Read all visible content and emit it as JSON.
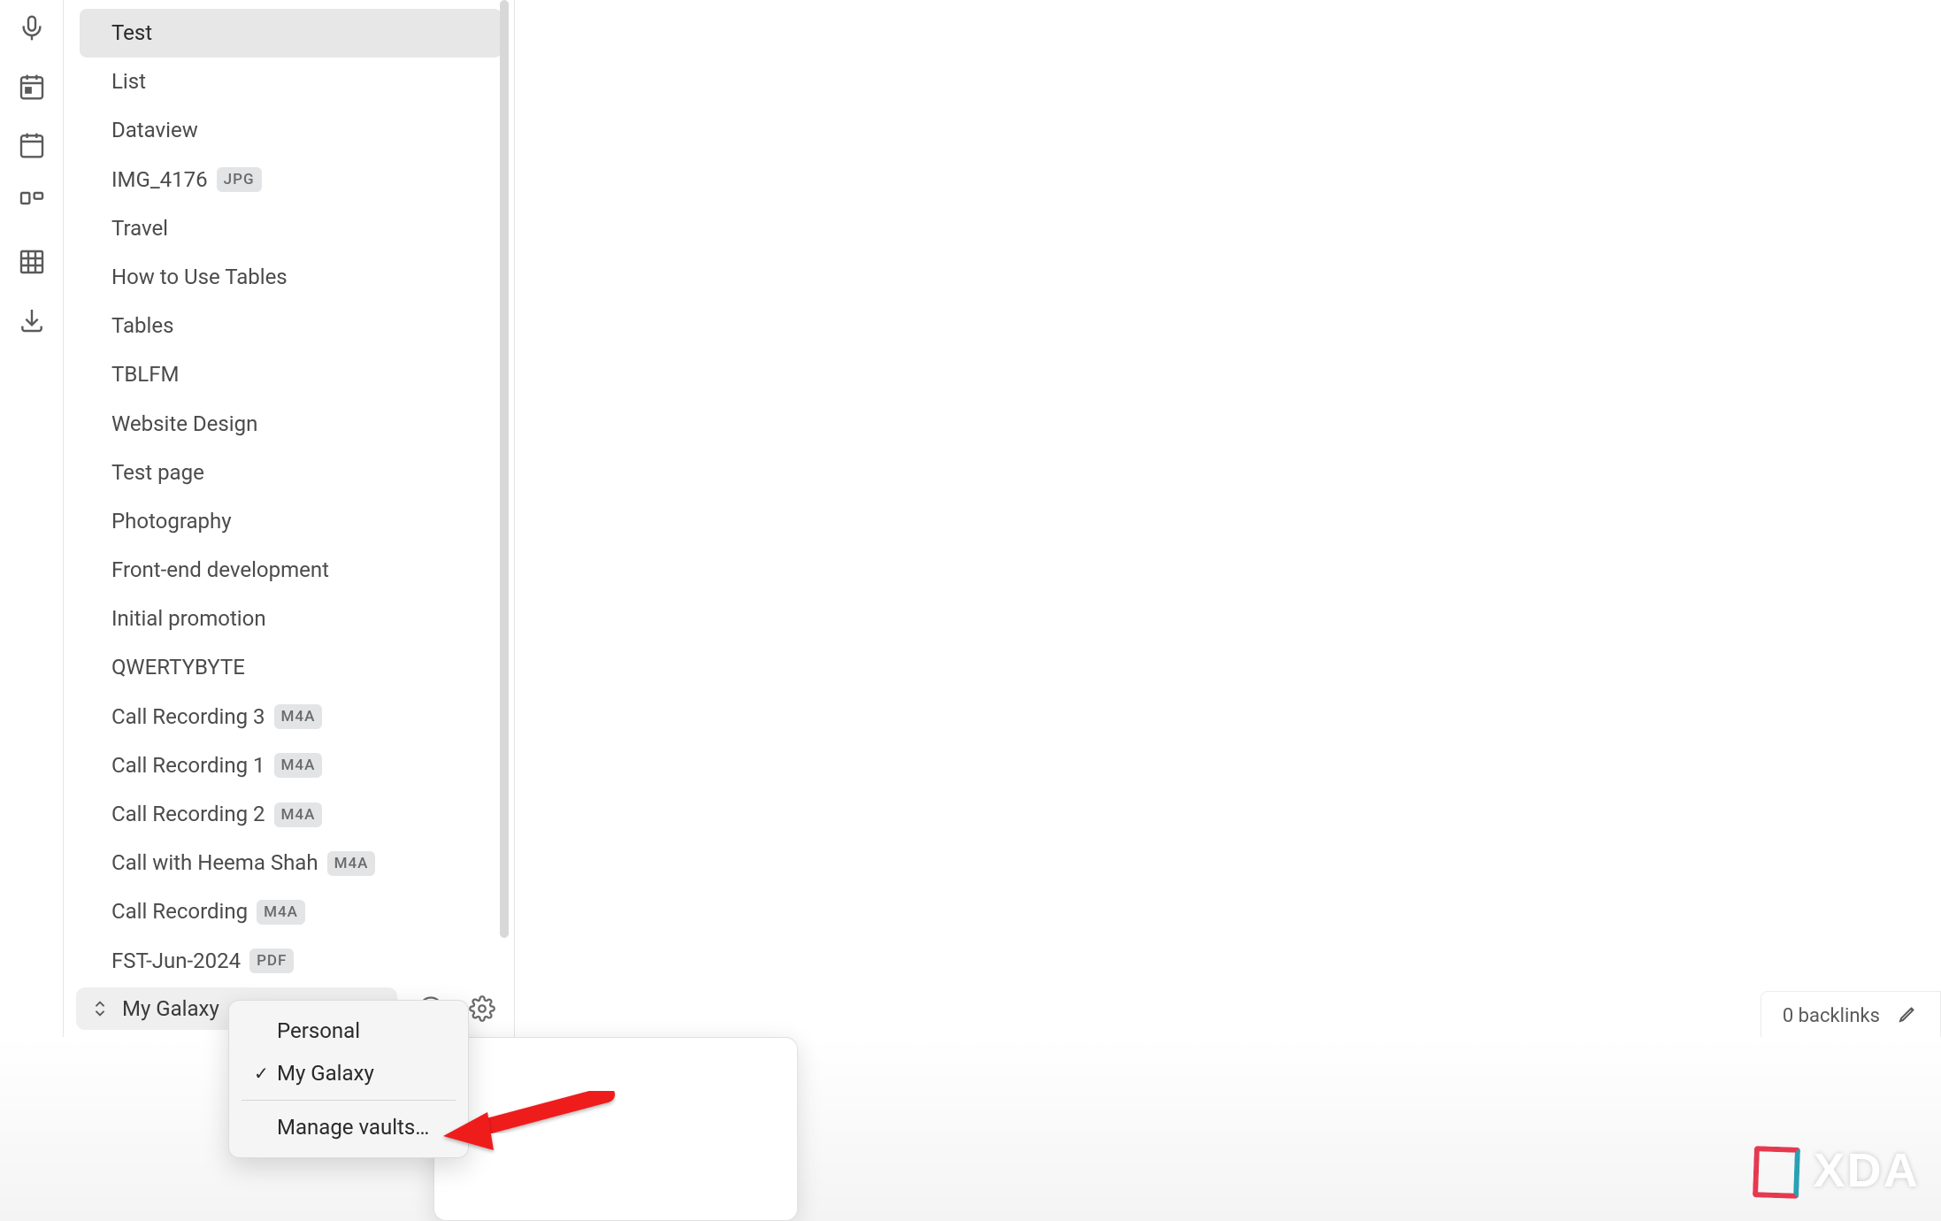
{
  "ribbon": {
    "items": [
      {
        "name": "mic",
        "icon": "mic"
      },
      {
        "name": "calendar-day",
        "icon": "calendar-day"
      },
      {
        "name": "calendar",
        "icon": "calendar"
      },
      {
        "name": "board",
        "icon": "board"
      },
      {
        "name": "table",
        "icon": "table"
      },
      {
        "name": "download",
        "icon": "download"
      }
    ]
  },
  "files": [
    {
      "label": "Test",
      "badge": null,
      "active": true
    },
    {
      "label": "List",
      "badge": null
    },
    {
      "label": "Dataview",
      "badge": null
    },
    {
      "label": "IMG_4176",
      "badge": "JPG"
    },
    {
      "label": "Travel",
      "badge": null
    },
    {
      "label": "How to Use Tables",
      "badge": null
    },
    {
      "label": "Tables",
      "badge": null
    },
    {
      "label": "TBLFM",
      "badge": null
    },
    {
      "label": "Website Design",
      "badge": null
    },
    {
      "label": "Test page",
      "badge": null
    },
    {
      "label": "Photography",
      "badge": null
    },
    {
      "label": "Front-end development",
      "badge": null
    },
    {
      "label": "Initial promotion",
      "badge": null
    },
    {
      "label": "QWERTYBYTE",
      "badge": null
    },
    {
      "label": "Call Recording 3",
      "badge": "M4A"
    },
    {
      "label": "Call Recording 1",
      "badge": "M4A"
    },
    {
      "label": "Call Recording 2",
      "badge": "M4A"
    },
    {
      "label": "Call with Heema Shah",
      "badge": "M4A"
    },
    {
      "label": "Call Recording",
      "badge": "M4A"
    },
    {
      "label": "FST-Jun-2024",
      "badge": "PDF"
    }
  ],
  "vault": {
    "current": "My Galaxy",
    "menu": {
      "items": [
        {
          "label": "Personal",
          "checked": false
        },
        {
          "label": "My Galaxy",
          "checked": true
        }
      ],
      "action": "Manage vaults…"
    }
  },
  "footer": {
    "help_icon": "help",
    "settings_icon": "settings"
  },
  "status": {
    "backlinks": "0 backlinks"
  },
  "watermark": "XDA"
}
